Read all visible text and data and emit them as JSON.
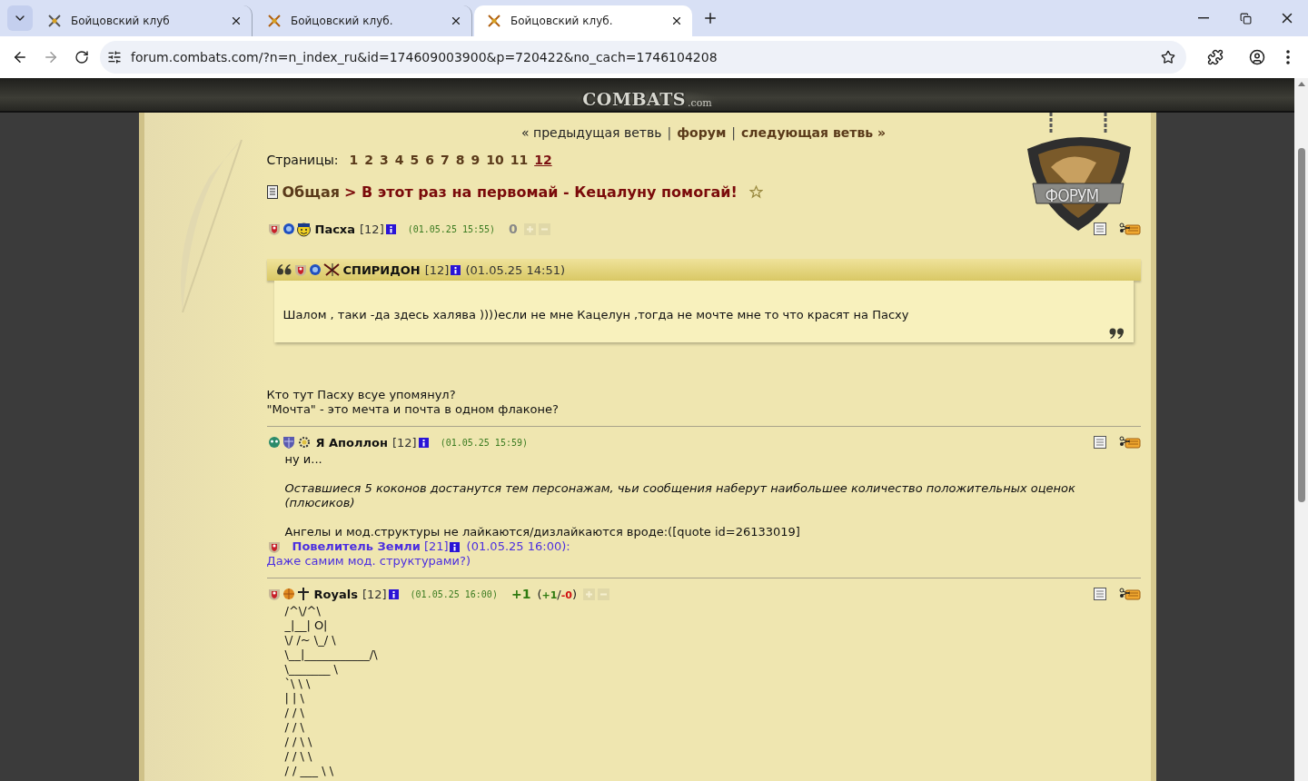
{
  "browser": {
    "tabs": [
      {
        "title": "Бойцовский клуб",
        "selected": false
      },
      {
        "title": "Бойцовский клуб.",
        "selected": false
      },
      {
        "title": "Бойцовский клуб.",
        "selected": true
      }
    ],
    "url": "forum.combats.com/?n=n_index_ru&id=174609003900&p=720422&no_cach=1746104208"
  },
  "site": {
    "logo": "COMBATS",
    "logo_suffix": ".com",
    "emblem": "ФОРУМ"
  },
  "nav": {
    "separator": "|",
    "links": [
      {
        "label": "« предыдущая ветвь",
        "bold": false
      },
      {
        "label": "форум",
        "bold": true
      },
      {
        "label": "следующая ветвь »",
        "bold": true
      }
    ]
  },
  "pages": {
    "label": "Страницы:",
    "items": [
      {
        "label": "1",
        "selected": false
      },
      {
        "label": "2",
        "selected": false
      },
      {
        "label": "3",
        "selected": false
      },
      {
        "label": "4",
        "selected": false
      },
      {
        "label": "5",
        "selected": false
      },
      {
        "label": "6",
        "selected": false
      },
      {
        "label": "7",
        "selected": false
      },
      {
        "label": "8",
        "selected": false
      },
      {
        "label": "9",
        "selected": false
      },
      {
        "label": "10",
        "selected": false
      },
      {
        "label": "11",
        "selected": false
      },
      {
        "label": "12",
        "selected": true
      }
    ]
  },
  "thread": {
    "section": "Общая",
    "title": "> В этот раз на первомай - Кецалуну помогай!"
  },
  "posts": [
    {
      "author": "Пасха",
      "level": "[12]",
      "date": "(01.05.25 15:55)",
      "rating": {
        "score": "0",
        "positive": false
      },
      "quote": {
        "author": "СПИРИДОН",
        "level": "[12]",
        "date": "(01.05.25 14:51)",
        "text": "Шалом , таки -да здесь халява ))))если не мне Кацелун ,тогда не мочте мне то что красят на Пасху"
      },
      "body": [
        {
          "kind": "flush",
          "lines": [
            "Кто тут Пасху всуе упомянул?",
            "\"Мочта\" - это мечта и почта в одном флаконе?"
          ]
        }
      ]
    },
    {
      "author": "Я Аполлон",
      "level": "[12]",
      "date": "(01.05.25 15:59)",
      "body": [
        {
          "kind": "text",
          "lines": [
            "ну и..."
          ]
        },
        {
          "kind": "italic",
          "lines": [
            "Оставшиеся 5 коконов достанутся тем персонажам, чьи сообщения наберут наибольшее количество положительных оценок",
            "(плюсиков)"
          ]
        },
        {
          "kind": "text",
          "lines": [
            "Ангелы и мод.структуры не лайкаются/дизлайкаются вроде:([quote id=26133019]"
          ]
        }
      ],
      "reply": {
        "author": "Повелитель Земли",
        "level": "[21]",
        "date": "(01.05.25 16:00):",
        "text": "Даже самим мод. структурами?)"
      }
    },
    {
      "author": "Royals",
      "level": "[12]",
      "date": "(01.05.25 16:00)",
      "rating": {
        "score": "+1",
        "positive": true,
        "open": "(",
        "plus": "+1",
        "sep": "/",
        "minus": "-0",
        "close": ")"
      },
      "body": [
        {
          "kind": "ascii",
          "lines": [
            "/^\\/^\\",
            "_|__| O|",
            "\\/ /~ \\_/ \\",
            "\\__|___________/\\",
            "\\_______ \\",
            "`\\ \\ \\",
            "| | \\",
            "/ / \\",
            "/ / \\",
            "/ / \\ \\",
            "/ / \\ \\",
            "/ / ___ \\ \\"
          ]
        }
      ]
    }
  ]
}
